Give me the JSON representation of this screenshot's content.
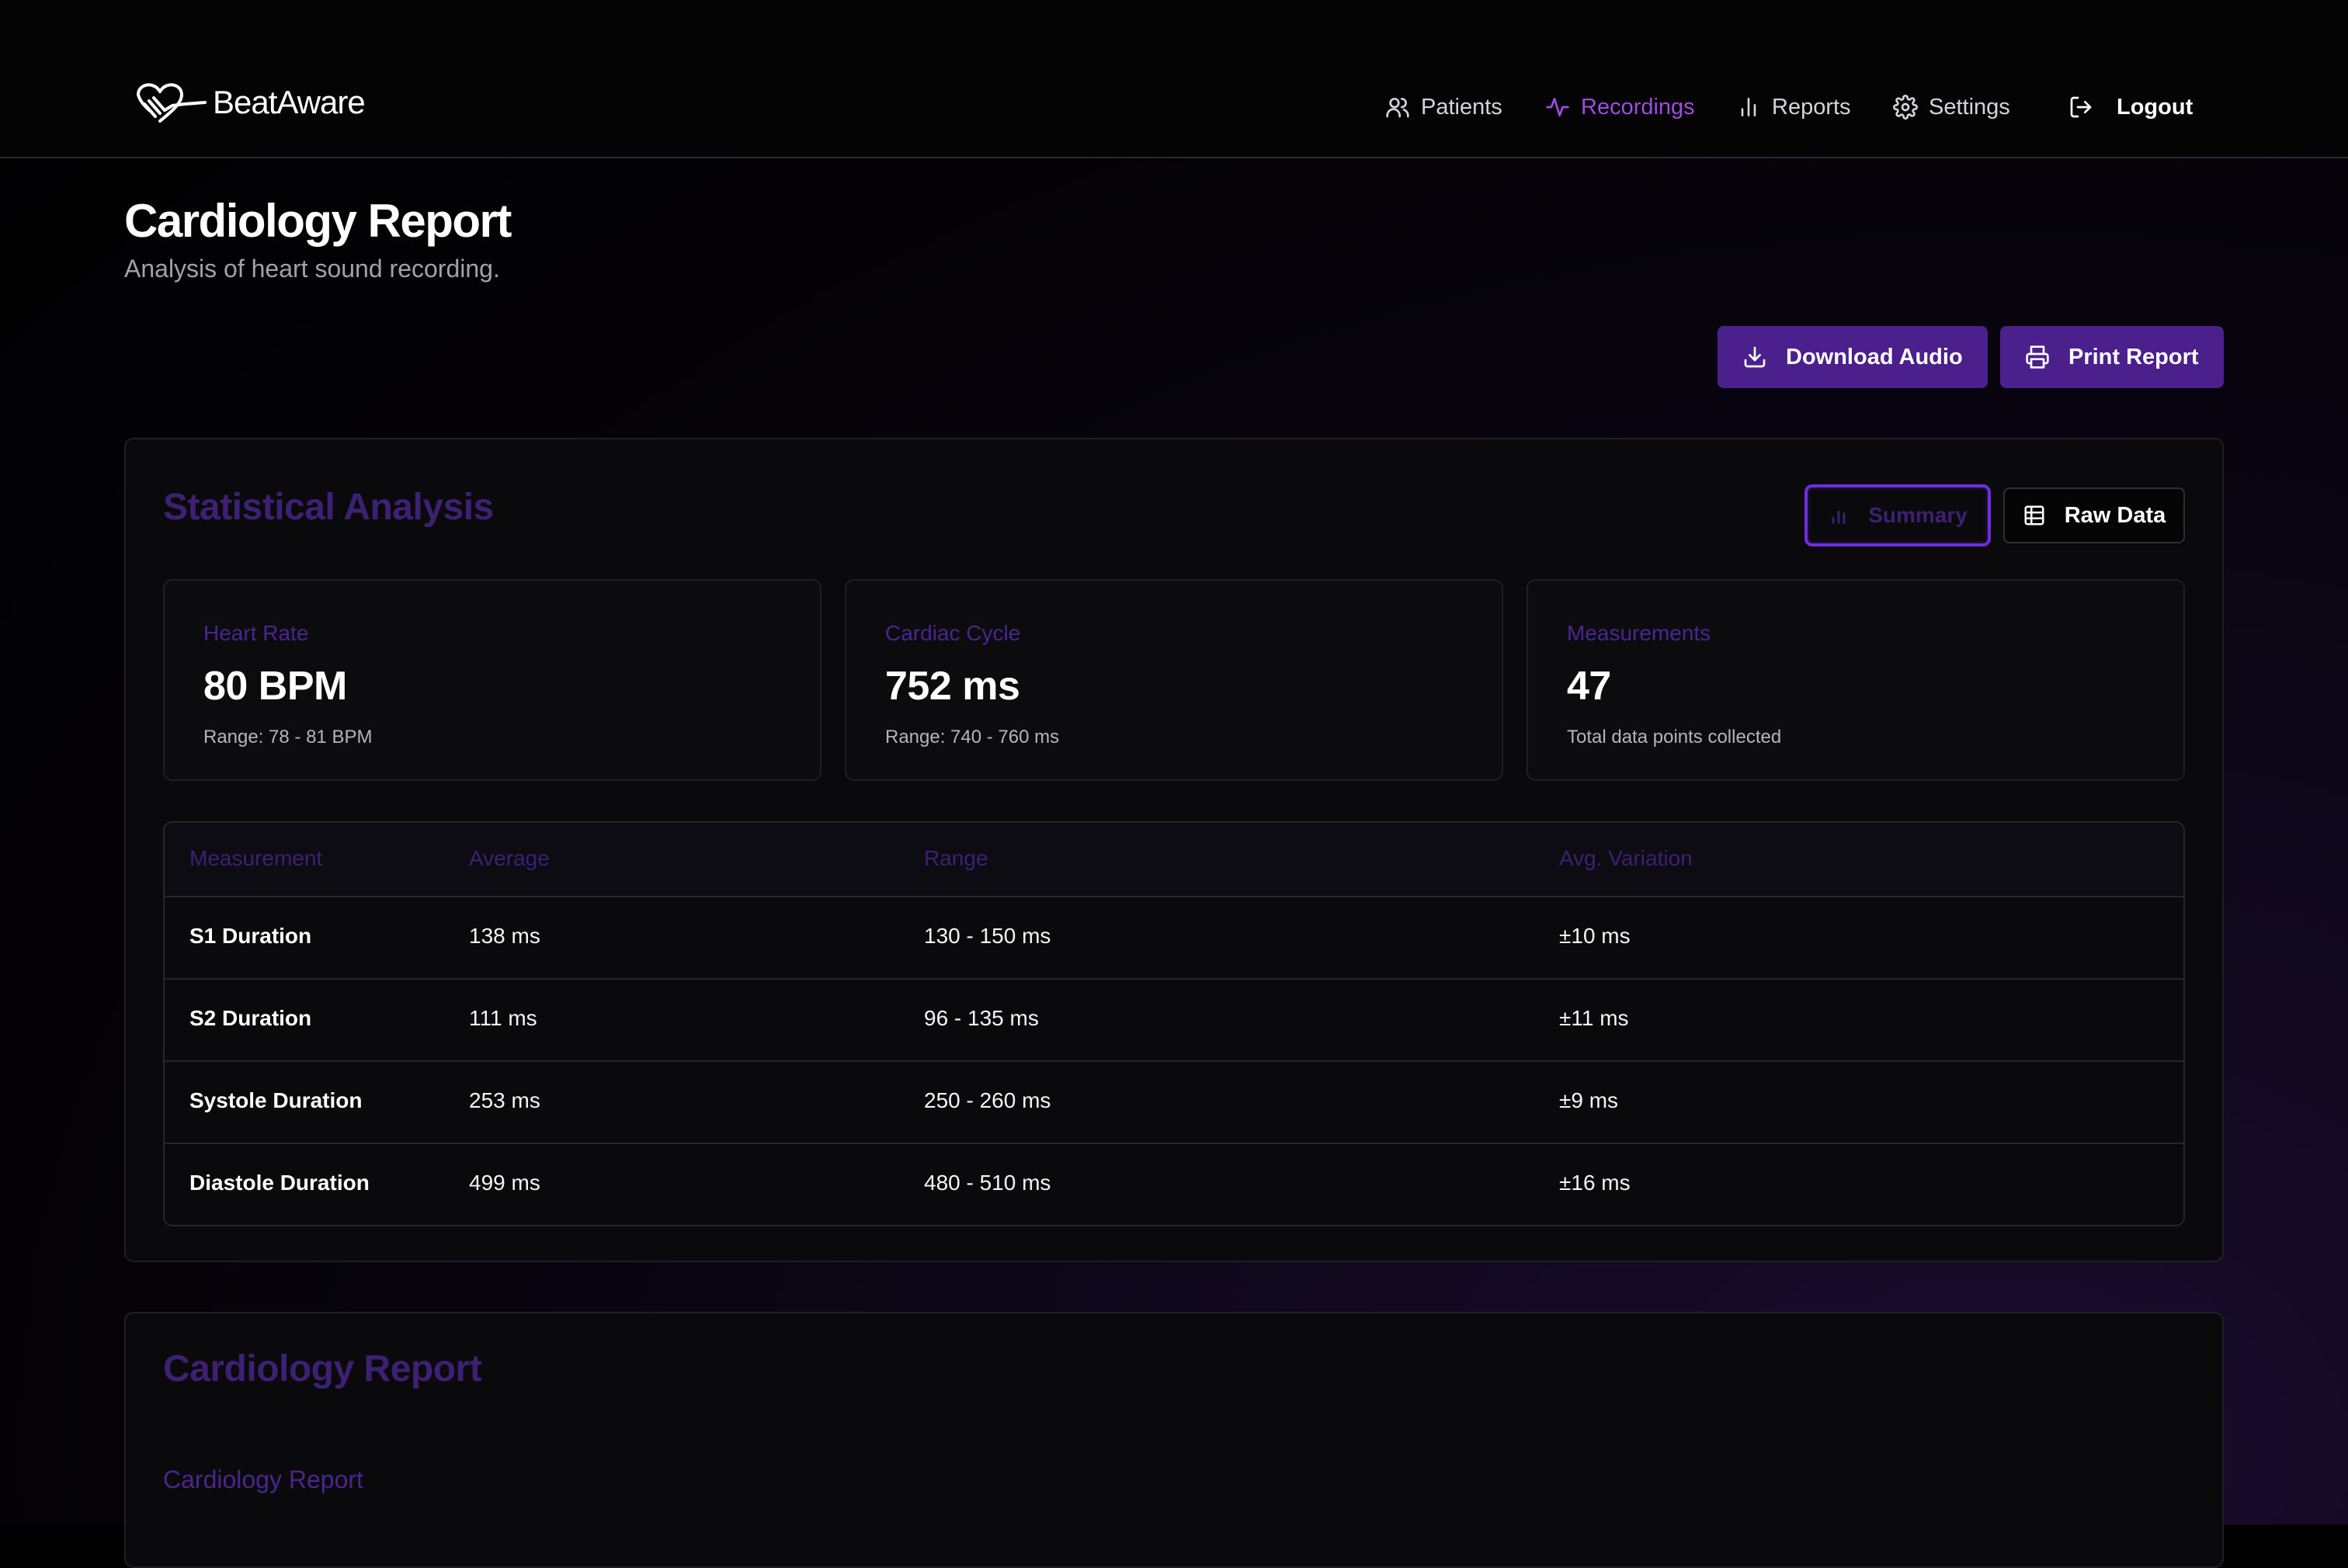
{
  "app": {
    "brand": "BeatAware"
  },
  "nav": {
    "patients": "Patients",
    "recordings": "Recordings",
    "reports": "Reports",
    "settings": "Settings",
    "logout": "Logout"
  },
  "header": {
    "title": "Cardiology Report",
    "subtitle": "Analysis of heart sound recording."
  },
  "actions": {
    "download": "Download Audio",
    "print": "Print Report"
  },
  "stats_section": {
    "title": "Statistical Analysis",
    "toggle_summary": "Summary",
    "toggle_raw": "Raw Data",
    "cards": [
      {
        "label": "Heart Rate",
        "value": "80 BPM",
        "note": "Range: 78 - 81 BPM"
      },
      {
        "label": "Cardiac Cycle",
        "value": "752 ms",
        "note": "Range: 740 - 760 ms"
      },
      {
        "label": "Measurements",
        "value": "47",
        "note": "Total data points collected"
      }
    ],
    "table": {
      "headers": [
        "Measurement",
        "Average",
        "Range",
        "Avg. Variation"
      ],
      "rows": [
        [
          "S1 Duration",
          "138 ms",
          "130 - 150 ms",
          "±10 ms"
        ],
        [
          "S2 Duration",
          "111 ms",
          "96 - 135 ms",
          "±11 ms"
        ],
        [
          "Systole Duration",
          "253 ms",
          "250 - 260 ms",
          "±9 ms"
        ],
        [
          "Diastole Duration",
          "499 ms",
          "480 - 510 ms",
          "±16 ms"
        ]
      ]
    }
  },
  "report_section": {
    "title": "Cardiology Report",
    "subtitle": "Cardiology Report"
  },
  "colors": {
    "accent": "#9b4dde",
    "button": "#4b1f8c",
    "muted_title": "#3d1f73"
  }
}
